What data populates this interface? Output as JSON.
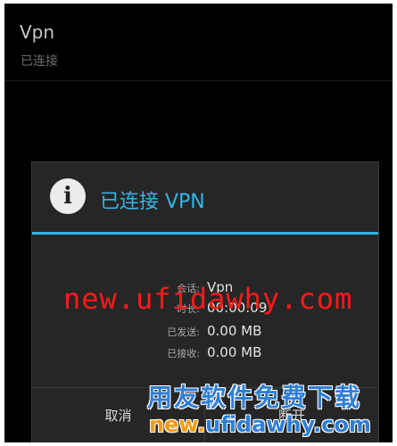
{
  "vpn_item": {
    "title": "Vpn",
    "status": "已连接"
  },
  "dialog": {
    "title": "已连接 VPN",
    "icon": "info-icon",
    "rows": [
      {
        "label": "会话:",
        "value": "Vpn"
      },
      {
        "label": "时长:",
        "value": "00:00:09"
      },
      {
        "label": "已发送:",
        "value": "0.00 MB"
      },
      {
        "label": "已接收:",
        "value": "0.00 MB"
      }
    ],
    "cancel_label": "取消",
    "disconnect_label": "断开"
  },
  "watermark": {
    "center_text": "new.ufidawhy.com",
    "cn_text": "用友软件免费下载",
    "url_prefix": "new.",
    "url_suffix": "ufidawhy.com"
  },
  "colors": {
    "accent": "#33b5e5",
    "background": "#000000",
    "dialog_background": "#262626",
    "watermark_red": "#ff1a1a",
    "watermark_blue": "#2f7fd6",
    "watermark_orange": "#f39c12"
  }
}
